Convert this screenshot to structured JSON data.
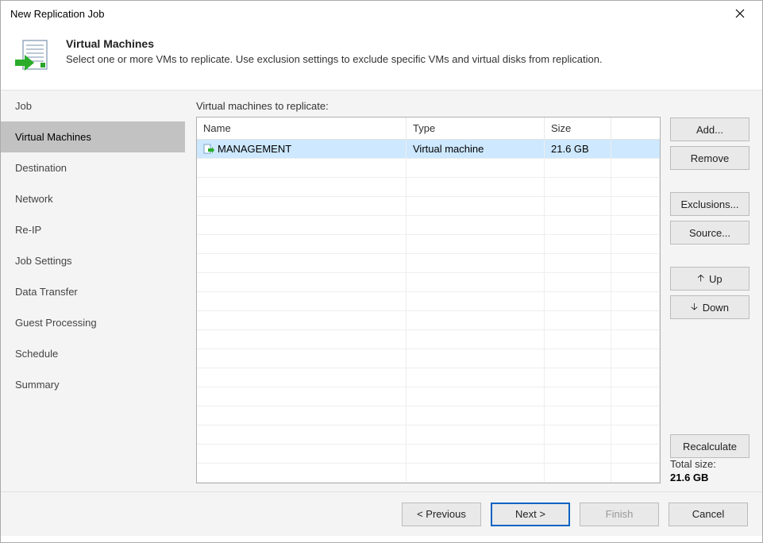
{
  "window": {
    "title": "New Replication Job"
  },
  "header": {
    "title": "Virtual Machines",
    "subtitle": "Select one or more VMs to replicate. Use exclusion settings to exclude specific VMs and virtual disks from replication."
  },
  "sidebar": {
    "items": [
      {
        "label": "Job"
      },
      {
        "label": "Virtual Machines",
        "active": true
      },
      {
        "label": "Destination"
      },
      {
        "label": "Network"
      },
      {
        "label": "Re-IP"
      },
      {
        "label": "Job Settings"
      },
      {
        "label": "Data Transfer"
      },
      {
        "label": "Guest Processing"
      },
      {
        "label": "Schedule"
      },
      {
        "label": "Summary"
      }
    ]
  },
  "main": {
    "caption": "Virtual machines to replicate:",
    "columns": {
      "name": "Name",
      "type": "Type",
      "size": "Size"
    },
    "rows": [
      {
        "name": "MANAGEMENT",
        "type": "Virtual machine",
        "size": "21.6 GB",
        "selected": true
      }
    ],
    "buttons": {
      "add": "Add...",
      "remove": "Remove",
      "exclusions": "Exclusions...",
      "source": "Source...",
      "up": "Up",
      "down": "Down",
      "recalculate": "Recalculate"
    },
    "total": {
      "label": "Total size:",
      "value": "21.6 GB"
    }
  },
  "footer": {
    "previous": "< Previous",
    "next": "Next >",
    "finish": "Finish",
    "cancel": "Cancel"
  }
}
